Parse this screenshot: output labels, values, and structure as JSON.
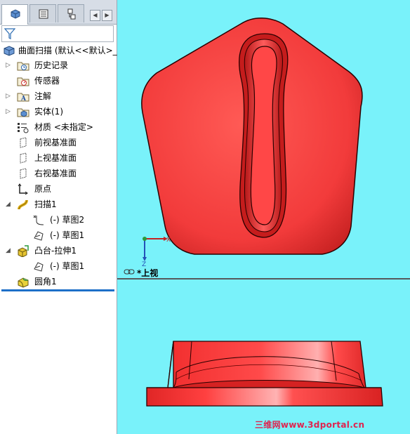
{
  "feature_tree": {
    "root": "曲面扫描 (默认<<默认>_",
    "items": [
      {
        "label": "历史记录",
        "icon": "history-folder-icon",
        "expandable": true
      },
      {
        "label": "传感器",
        "icon": "sensor-icon",
        "expandable": false
      },
      {
        "label": "注解",
        "icon": "annotations-icon",
        "expandable": true
      },
      {
        "label": "实体(1)",
        "icon": "solid-bodies-icon",
        "expandable": true
      },
      {
        "label": "材质 <未指定>",
        "icon": "material-icon",
        "expandable": false
      },
      {
        "label": "前视基准面",
        "icon": "plane-icon",
        "expandable": false
      },
      {
        "label": "上视基准面",
        "icon": "plane-icon",
        "expandable": false
      },
      {
        "label": "右视基准面",
        "icon": "plane-icon",
        "expandable": false
      },
      {
        "label": "原点",
        "icon": "origin-icon",
        "expandable": false
      },
      {
        "label": "扫描1",
        "icon": "sweep-icon",
        "expandable": "expanded"
      },
      {
        "label": "(-) 草图2",
        "icon": "sketch-icon",
        "expandable": false
      },
      {
        "label": "(-) 草图1",
        "icon": "sketch-icon",
        "expandable": false
      },
      {
        "label": "凸台-拉伸1",
        "icon": "extrude-icon",
        "expandable": "expanded"
      },
      {
        "label": "(-) 草图1",
        "icon": "sketch-icon",
        "expandable": false
      },
      {
        "label": "圆角1",
        "icon": "fillet-icon",
        "expandable": false
      }
    ]
  },
  "viewport": {
    "view_label": "*上视",
    "triad": {
      "x": "X",
      "z": "Z"
    },
    "background_color": "#79f2fa",
    "model_color": "#ff3b3b"
  },
  "watermark": "三维网www.3dportal.cn"
}
